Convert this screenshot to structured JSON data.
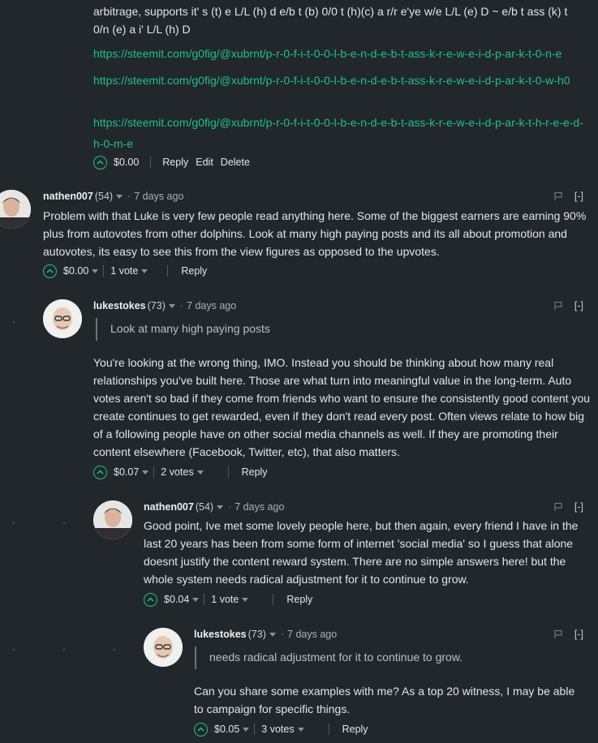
{
  "top": {
    "text": "arbitrage, supports it' s (t) e L/L (h) d e/b t (b) 0/0 t (h)(c) a r/r e'ye w/e L/L (e) D ~ e/b t ass (k) t 0/n (e) a i' L/L (h) D",
    "links": [
      "https://steemit.com/g0fig/@xubrnt/p-r-0-f-i-t-0-0-l-b-e-n-d-e-b-t-ass-k-r-e-w-e-i-d-p-ar-k-t-0-n-e",
      "https://steemit.com/g0fig/@xubrnt/p-r-0-f-i-t-0-0-l-b-e-n-d-e-b-t-ass-k-r-e-w-e-i-d-p-ar-k-t-0-w-h0",
      "https://steemit.com/g0fig/@xubrnt/p-r-0-f-i-t-0-0-l-b-e-n-d-e-b-t-ass-k-r-e-w-e-i-d-p-ar-k-t-h-r-e-e-d-h-0-m-e"
    ],
    "payout": "$0.00",
    "reply": "Reply",
    "edit": "Edit",
    "delete": "Delete"
  },
  "comments": [
    {
      "author": "nathen007",
      "rep": "(54)",
      "time": "7 days ago",
      "collapse": "[-]",
      "body": "Problem with that Luke is very few people read anything here. Some of the biggest earners are earning 90% plus from autovotes from other dolphins. Look at many high paying posts and its all about promotion and autovotes, its easy to see this from the view figures as opposed to the upvotes.",
      "payout": "$0.00",
      "votes": "1 vote",
      "reply": "Reply"
    },
    {
      "author": "lukestokes",
      "rep": "(73)",
      "time": "7 days ago",
      "collapse": "[-]",
      "quote": "Look at many high paying posts",
      "body": "You're looking at the wrong thing, IMO. Instead you should be thinking about how many real relationships you've built here. Those are what turn into meaningful value in the long-term. Auto votes aren't so bad if they come from friends who want to ensure the consistently good content you create continues to get rewarded, even if they don't read every post. Often views relate to how big of a following people have on other social media channels as well. If they are promoting their content elsewhere (Facebook, Twitter, etc), that also matters.",
      "payout": "$0.07",
      "votes": "2 votes",
      "reply": "Reply"
    },
    {
      "author": "nathen007",
      "rep": "(54)",
      "time": "7 days ago",
      "collapse": "[-]",
      "body": "Good point, Ive met some lovely people here, but then again, every friend I have in the last 20 years has been from some form of internet 'social media' so I guess that alone doesnt justify the content reward system. There are no simple answers here! but the whole system needs radical adjustment for it to continue to grow.",
      "payout": "$0.04",
      "votes": "1 vote",
      "reply": "Reply"
    },
    {
      "author": "lukestokes",
      "rep": "(73)",
      "time": "7 days ago",
      "collapse": "[-]",
      "quote": "needs radical adjustment for it to continue to grow.",
      "body": "Can you share some examples with me? As a top 20 witness, I may be able to campaign for specific things.",
      "payout": "$0.05",
      "votes": "3 votes",
      "reply": "Reply"
    }
  ],
  "colors": {
    "background": "#22272b",
    "link": "#1fbf8f",
    "text": "#e3e6e8"
  }
}
